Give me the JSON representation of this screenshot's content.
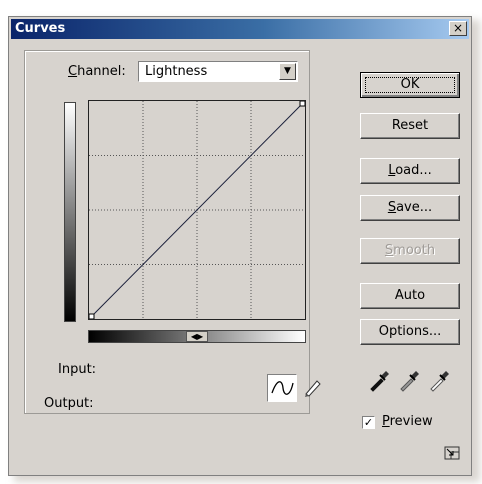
{
  "window": {
    "title": "Curves",
    "close_glyph": "×"
  },
  "channel": {
    "label_underlined": "C",
    "label_rest": "hannel:",
    "value": "Lightness",
    "arrow": "▼"
  },
  "labels": {
    "input": "Input:",
    "output": "Output:"
  },
  "buttons": {
    "ok": "OK",
    "reset": "Reset",
    "load_u": "L",
    "load_rest": "oad...",
    "save_u": "S",
    "save_rest": "ave...",
    "smooth_u": "S",
    "smooth_rest": "mooth",
    "auto": "Auto",
    "options": "Options..."
  },
  "preview": {
    "label_underlined": "P",
    "label_rest": "review",
    "checked": "✓"
  },
  "slider_handle": "◀▶",
  "icons": [
    "curve-tool-icon",
    "pencil-icon",
    "black-eyedropper-icon",
    "gray-eyedropper-icon",
    "white-eyedropper-icon",
    "resize-icon"
  ]
}
